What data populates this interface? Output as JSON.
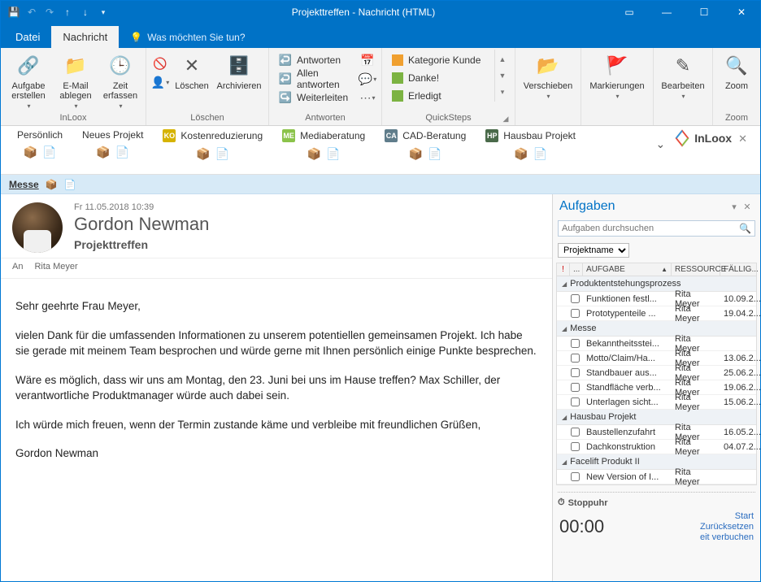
{
  "window": {
    "title": "Projekttreffen  -  Nachricht (HTML)"
  },
  "tabs": {
    "file": "Datei",
    "message": "Nachricht",
    "tellme": "Was möchten Sie tun?"
  },
  "ribbon": {
    "inloox": {
      "label": "InLoox",
      "task_create": "Aufgabe\nerstellen",
      "email_file": "E-Mail\nablegen",
      "time_record": "Zeit\nerfassen"
    },
    "delete": {
      "label": "Löschen",
      "delete": "Löschen",
      "archive": "Archivieren"
    },
    "respond": {
      "label": "Antworten",
      "reply": "Antworten",
      "replyall": "Allen antworten",
      "forward": "Weiterleiten"
    },
    "quicksteps": {
      "label": "QuickSteps",
      "items": [
        "Kategorie Kunde",
        "Danke!",
        "Erledigt"
      ]
    },
    "move": {
      "label": "Verschieben",
      "btn": "Verschieben"
    },
    "tags": {
      "label": "Markierungen",
      "btn": "Markierungen"
    },
    "edit": {
      "label": "Bearbeiten",
      "btn": "Bearbeiten"
    },
    "zoom": {
      "label": "Zoom",
      "btn": "Zoom"
    }
  },
  "projects": {
    "items": [
      {
        "name": "Persönlich",
        "badge": "",
        "color": ""
      },
      {
        "name": "Neues Projekt",
        "badge": "",
        "color": ""
      },
      {
        "name": "Kostenreduzierung",
        "badge": "KO",
        "color": "#d6b300"
      },
      {
        "name": "Mediaberatung",
        "badge": "ME",
        "color": "#8bc34a"
      },
      {
        "name": "CAD-Beratung",
        "badge": "CA",
        "color": "#607d8b"
      },
      {
        "name": "Hausbau Projekt",
        "badge": "HP",
        "color": "#4a6a4a"
      }
    ],
    "brand": "InLoox"
  },
  "breadcrumb": {
    "label": "Messe"
  },
  "message": {
    "date": "Fr 11.05.2018 10:39",
    "from": "Gordon Newman",
    "subject": "Projekttreffen",
    "to_label": "An",
    "to": "Rita Meyer",
    "body": {
      "p1": "Sehr geehrte Frau Meyer,",
      "p2": "vielen Dank für die umfassenden Informationen zu unserem potentiellen gemeinsamen Projekt. Ich habe sie gerade mit meinem Team besprochen und würde gerne mit Ihnen persönlich einige Punkte besprechen.",
      "p3": "Wäre es möglich, dass wir uns am Montag, den 23. Juni bei uns im Hause treffen? Max Schiller, der verantwortliche Produktmanager würde auch dabei sein.",
      "p4": "Ich würde mich freuen, wenn der Termin zustande käme und verbleibe mit freundlichen Grüßen,",
      "p5": "Gordon Newman"
    }
  },
  "taskpane": {
    "title": "Aufgaben",
    "search_placeholder": "Aufgaben durchsuchen",
    "filter": "Projektname",
    "cols": {
      "task": "AUFGABE",
      "resource": "RESSOURCE",
      "due": "FÄLLIG..."
    },
    "groups": [
      {
        "name": "Produktentstehungsprozess",
        "rows": [
          {
            "name": "Funktionen festl...",
            "res": "Rita Meyer",
            "due": "10.09.2..."
          },
          {
            "name": "Prototypenteile ...",
            "res": "Rita Meyer",
            "due": "19.04.2..."
          }
        ]
      },
      {
        "name": "Messe",
        "rows": [
          {
            "name": "Bekanntheitsstei...",
            "res": "Rita Meyer",
            "due": ""
          },
          {
            "name": "Motto/Claim/Ha...",
            "res": "Rita Meyer",
            "due": "13.06.2..."
          },
          {
            "name": "Standbauer aus...",
            "res": "Rita Meyer",
            "due": "25.06.2..."
          },
          {
            "name": "Standfläche verb...",
            "res": "Rita Meyer",
            "due": "19.06.2..."
          },
          {
            "name": "Unterlagen sicht...",
            "res": "Rita Meyer",
            "due": "15.06.2..."
          }
        ]
      },
      {
        "name": "Hausbau Projekt",
        "rows": [
          {
            "name": "Baustellenzufahrt",
            "res": "Rita Meyer",
            "due": "16.05.2..."
          },
          {
            "name": "Dachkonstruktion",
            "res": "Rita Meyer",
            "due": "04.07.2..."
          }
        ]
      },
      {
        "name": "Facelift Produkt II",
        "rows": [
          {
            "name": "New Version of I...",
            "res": "Rita Meyer",
            "due": ""
          }
        ]
      }
    ],
    "stopwatch": {
      "label": "Stoppuhr",
      "time": "00:00",
      "start": "Start",
      "reset": "Zurücksetzen",
      "book": "eit verbuchen"
    }
  }
}
